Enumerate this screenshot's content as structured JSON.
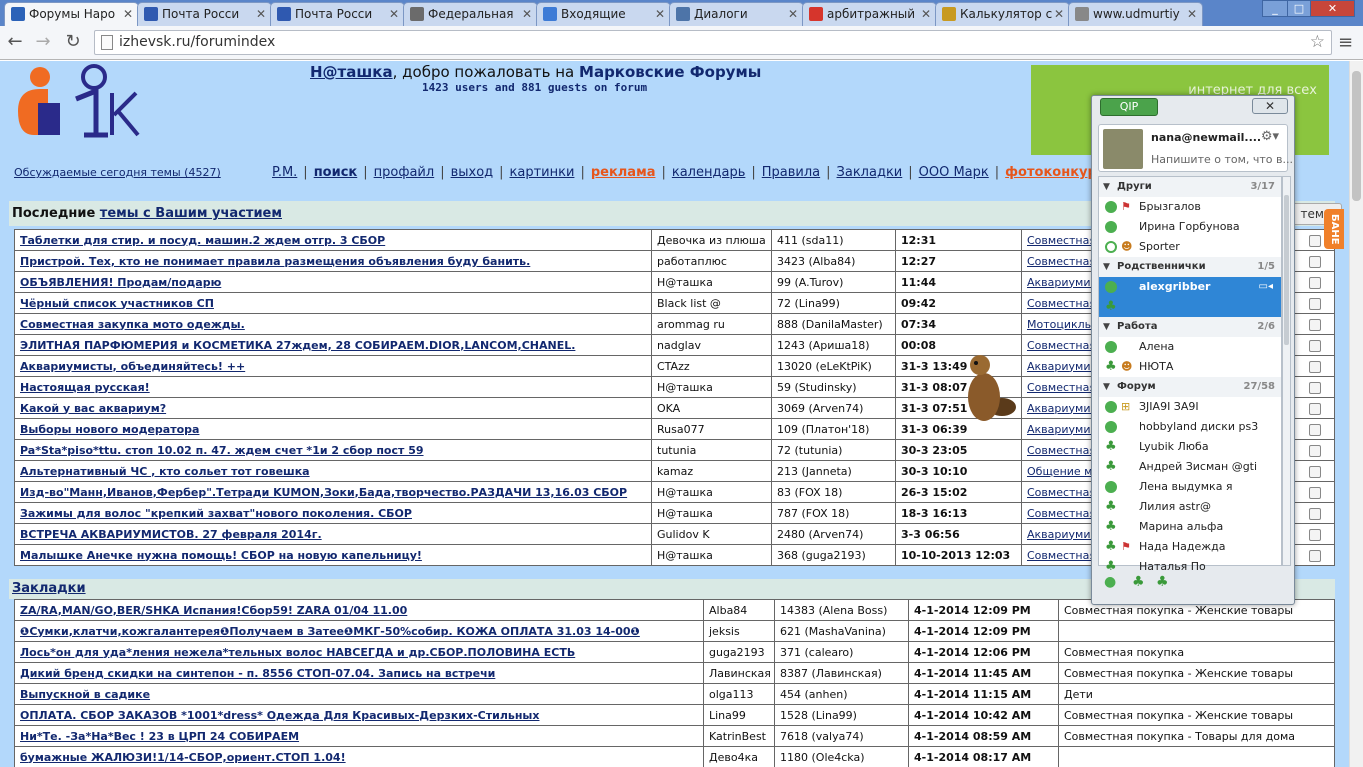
{
  "browser": {
    "tabs": [
      {
        "title": "Форумы Наро",
        "active": true,
        "icon_color": "#2b62b8"
      },
      {
        "title": "Почта Росси",
        "active": false,
        "icon_color": "#2f59b0"
      },
      {
        "title": "Почта Росси",
        "active": false,
        "icon_color": "#2f59b0"
      },
      {
        "title": "Федеральная",
        "active": false,
        "icon_color": "#6b6b6b"
      },
      {
        "title": "Входящие",
        "active": false,
        "icon_color": "#3d7bd6"
      },
      {
        "title": "Диалоги",
        "active": false,
        "icon_color": "#4d74a8"
      },
      {
        "title": "арбитражный",
        "active": false,
        "icon_color": "#d6352c"
      },
      {
        "title": "Калькулятор с",
        "active": false,
        "icon_color": "#c89a20"
      },
      {
        "title": "www.udmurtiy",
        "active": false,
        "icon_color": "#888888"
      }
    ],
    "url": "izhevsk.ru/forumindex"
  },
  "header": {
    "user_link": "Н@ташка",
    "welcome_text": ", добро пожаловать на ",
    "forum_name": "Марковские Форумы",
    "online": "1423 users and 881 guests on forum",
    "banner_text": "интернет для всех"
  },
  "today_topics": "Обсуждаемые сегодня темы (4527)",
  "navlinks": {
    "pm": "P.M.",
    "search": "поиск",
    "profile": "профайл",
    "logout": "выход",
    "pictures": "картинки",
    "ads": "реклама",
    "calendar": "календарь",
    "rules": "Правила",
    "bookmarks": "Закладки",
    "company": "ООО Марк",
    "photo": "фотоконкур"
  },
  "section1": {
    "prefix": "Последние ",
    "link": "темы с Вашим участием",
    "themes_btn": "темы"
  },
  "recent_rows": [
    {
      "topic": "Таблетки для стир. и посуд. машин.2 ждем отгр. 3 СБОР",
      "author": "Девочка из плюша",
      "stats": "411 (sda11)",
      "time": "12:31",
      "forum": "Совместная"
    },
    {
      "topic": "Пристрой. Тех, кто не понимает правила размещения объявления буду банить.",
      "author": "работаплюс",
      "stats": "3423 (Alba84)",
      "time": "12:27",
      "forum": "Совместная"
    },
    {
      "topic": "ОБЪЯВЛЕНИЯ! Продам/подарю",
      "author": "Н@ташка",
      "stats": "99 (A.Turov)",
      "time": "11:44",
      "forum": "Аквариумист"
    },
    {
      "topic": "Чёрный список участников СП",
      "author": "Black list @",
      "stats": "72 (Lina99)",
      "time": "09:42",
      "forum": "Совместная"
    },
    {
      "topic": "Совместная закупка мото одежды.",
      "author": "arommag ru",
      "stats": "888 (DanilaMaster)",
      "time": "07:34",
      "forum": "Мотоциклы"
    },
    {
      "topic": "ЭЛИТНАЯ ПАРФЮМЕРИЯ и КОСМЕТИКА 27ждем, 28 СОБИРАЕМ.DIOR,LANCOM,CHANEL.",
      "author": "nadglav",
      "stats": "1243 (Ариша18)",
      "time": "00:08",
      "forum": "Совместная"
    },
    {
      "topic": "Аквариумисты, объединяйтесь! ++",
      "author": "CTAzz",
      "stats": "13020 (eLeKtPiK)",
      "time": "31-3 13:49",
      "forum": "Аквариумист"
    },
    {
      "topic": "Настоящая русская!",
      "author": "Н@ташка",
      "stats": "59 (Studinsky)",
      "time": "31-3 08:07",
      "forum": "Совместная"
    },
    {
      "topic": "Какой у вас аквариум?",
      "author": "OKA",
      "stats": "3069 (Arven74)",
      "time": "31-3 07:51",
      "forum": "Аквариумист"
    },
    {
      "topic": "Выборы нового модератора",
      "author": "Rusa077",
      "stats": "109 (Платон'18)",
      "time": "31-3 06:39",
      "forum": "Аквариумист"
    },
    {
      "topic": "Pa*Sta*piso*ttu. стоп 10.02 п. 47. ждем счет *1и 2 сбор пост 59",
      "author": "tutunia",
      "stats": "72 (tutunia)",
      "time": "30-3 23:05",
      "forum": "Совместная"
    },
    {
      "topic": "Альтернативный ЧС , кто сольет тот говешка",
      "author": "kamaz",
      "stats": "213 (Janneta)",
      "time": "30-3 10:10",
      "forum": "Общение мо"
    },
    {
      "topic": "Изд-во\"Манн,Иванов,Фербер\".Тетради KUMON,Зоки,Бада,творчество.РАЗДАЧИ 13,16.03 СБОР",
      "author": "Н@ташка",
      "stats": "83 (FOX 18)",
      "time": "26-3 15:02",
      "forum": "Совместная"
    },
    {
      "topic": "Зажимы для волос \"крепкий захват\"нового поколения. СБОР",
      "author": "Н@ташка",
      "stats": "787 (FOX 18)",
      "time": "18-3 16:13",
      "forum": "Совместная"
    },
    {
      "topic": "ВСТРЕЧА АКВАРИУМИСТОВ. 27 февраля 2014г.",
      "author": "Gulidov K",
      "stats": "2480 (Arven74)",
      "time": "3-3 06:56",
      "forum": "Аквариумист"
    },
    {
      "topic": "Малышке Анечке нужна помощь! СБОР на новую капельницу!",
      "author": "Н@ташка",
      "stats": "368 (guga2193)",
      "time": "10-10-2013 12:03",
      "forum": "Совместная"
    }
  ],
  "section2": {
    "title": "Закладки"
  },
  "bookmark_rows": [
    {
      "topic": "ZA/RA,MAN/GO,BER/SHKA Испания!Сбор59! ZARA 01/04 11.00",
      "author": "Alba84",
      "stats": "14383 (Alena Boss)",
      "time": "4-1-2014 12:09 PM",
      "forum": "Совместная покупка - Женские товары"
    },
    {
      "topic": "❶Сумки,клатчи,кожгалантерея❶Получаем в Затее❶МКГ-50%собир. КОЖА ОПЛАТА 31.03 14-00❶",
      "author": "jeksis",
      "stats": "621 (MashaVanina)",
      "time": "4-1-2014 12:09 PM",
      "forum": ""
    },
    {
      "topic": "Лось*он для уда*ления нежела*тельных волос НАВСЕГДА и др.СБОР.ПОЛОВИНА ЕСТЬ",
      "author": "guga2193",
      "stats": "371 (calearo)",
      "time": "4-1-2014 12:06 PM",
      "forum": "Совместная покупка"
    },
    {
      "topic": "Дикий бренд скидки на синтепон - п. 8556 СТОП-07.04. Запись на встречи",
      "author": "Лавинская",
      "stats": "8387 (Лавинская)",
      "time": "4-1-2014 11:45 AM",
      "forum": "Совместная покупка - Женские товары"
    },
    {
      "topic": "Выпускной в садике",
      "author": "olga113",
      "stats": "454 (anhen)",
      "time": "4-1-2014 11:15 AM",
      "forum": "Дети"
    },
    {
      "topic": "ОПЛАТА. СБОР ЗАКАЗОВ *1001*dress* Одежда Для Красивых-Дерзких-Стильных",
      "author": "Lina99",
      "stats": "1528 (Lina99)",
      "time": "4-1-2014 10:42 AM",
      "forum": "Совместная покупка - Женские товары"
    },
    {
      "topic": "Ни*Те. -За*На*Вес ! 23 в ЦРП 24 СОБИРАЕМ",
      "author": "KatrinBest",
      "stats": "7618 (valya74)",
      "time": "4-1-2014 08:59 AM",
      "forum": "Совместная покупка - Товары для дома"
    },
    {
      "topic": "бумажные ЖАЛЮЗИ!1/14-СБОР,ориент.СТОП 1.04!",
      "author": "Дево4ка",
      "stats": "1180 (Ole4cka)",
      "time": "4-1-2014 08:17 AM",
      "forum": ""
    }
  ],
  "qip": {
    "badge": "QIP",
    "account": "nana@newmail....",
    "status_prompt": "Напишите о том, что в...",
    "items": [
      {
        "kind": "group",
        "name": "Други",
        "count": "3/17"
      },
      {
        "kind": "contact",
        "name": "Брызгалов",
        "status": "online",
        "extra": "flag"
      },
      {
        "kind": "contact",
        "name": "Ирина Горбунова",
        "status": "online"
      },
      {
        "kind": "contact",
        "name": "Sporter",
        "status": "away",
        "extra": "person"
      },
      {
        "kind": "group",
        "name": "Родственнички",
        "count": "1/5"
      },
      {
        "kind": "contact",
        "name": "alexgribber",
        "status": "online",
        "selected": true,
        "extra": "video"
      },
      {
        "kind": "contact",
        "name": "",
        "status": "clover",
        "selected": true
      },
      {
        "kind": "group",
        "name": "Работа",
        "count": "2/6"
      },
      {
        "kind": "contact",
        "name": "Алена",
        "status": "online"
      },
      {
        "kind": "contact",
        "name": "НЮТА",
        "status": "clover",
        "extra": "person"
      },
      {
        "kind": "group",
        "name": "Форум",
        "count": "27/58"
      },
      {
        "kind": "contact",
        "name": "ЗJIA9I ЗA9I",
        "status": "online",
        "extra": "cart"
      },
      {
        "kind": "contact",
        "name": "hobbyland диски ps3",
        "status": "online"
      },
      {
        "kind": "contact",
        "name": "Lyubik Люба",
        "status": "clover"
      },
      {
        "kind": "contact",
        "name": "Андрей Зисман @gti",
        "status": "clover"
      },
      {
        "kind": "contact",
        "name": "Лена выдумка я",
        "status": "online"
      },
      {
        "kind": "contact",
        "name": "Лилия astr@",
        "status": "clover"
      },
      {
        "kind": "contact",
        "name": "Марина альфа",
        "status": "clover"
      },
      {
        "kind": "contact",
        "name": "Нада Надежда",
        "status": "clover",
        "extra": "flag"
      },
      {
        "kind": "contact",
        "name": "Наталья По",
        "status": "clover"
      }
    ]
  },
  "side_tab": "БАНЕ"
}
